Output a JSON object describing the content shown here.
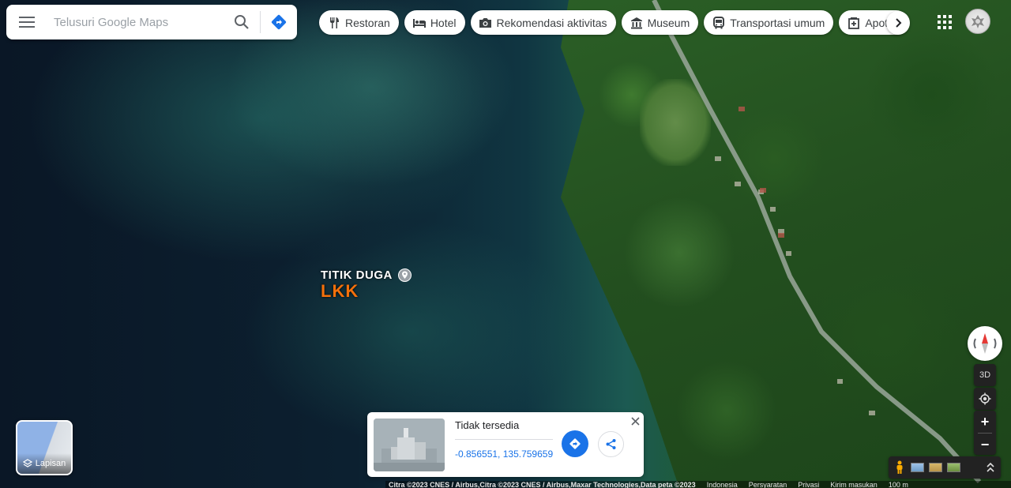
{
  "search": {
    "placeholder": "Telusuri Google Maps"
  },
  "chips": [
    {
      "label": "Restoran",
      "icon": "fork-knife-icon"
    },
    {
      "label": "Hotel",
      "icon": "bed-icon"
    },
    {
      "label": "Rekomendasi aktivitas",
      "icon": "camera-icon"
    },
    {
      "label": "Museum",
      "icon": "museum-icon"
    },
    {
      "label": "Transportasi umum",
      "icon": "bus-icon"
    },
    {
      "label": "Apotek",
      "icon": "pharmacy-icon"
    }
  ],
  "place": {
    "line1": "TITIK DUGA",
    "line2": "LKK"
  },
  "layers": {
    "label": "Lapisan"
  },
  "card": {
    "title": "Tidak tersedia",
    "coords": "-0.856551, 135.759659"
  },
  "controls": {
    "three_d": "3D",
    "zoom_in": "+",
    "zoom_out": "−"
  },
  "footer": {
    "attribution": "Citra ©2023 CNES / Airbus,Citra ©2023 CNES / Airbus,Maxar Technologies,Data peta ©2023",
    "links": [
      "Indonesia",
      "Persyaratan",
      "Privasi",
      "Kirim masukan"
    ],
    "scale": "100 m"
  },
  "colors": {
    "accent": "#1a73e8",
    "place_label": "#f4700b"
  }
}
